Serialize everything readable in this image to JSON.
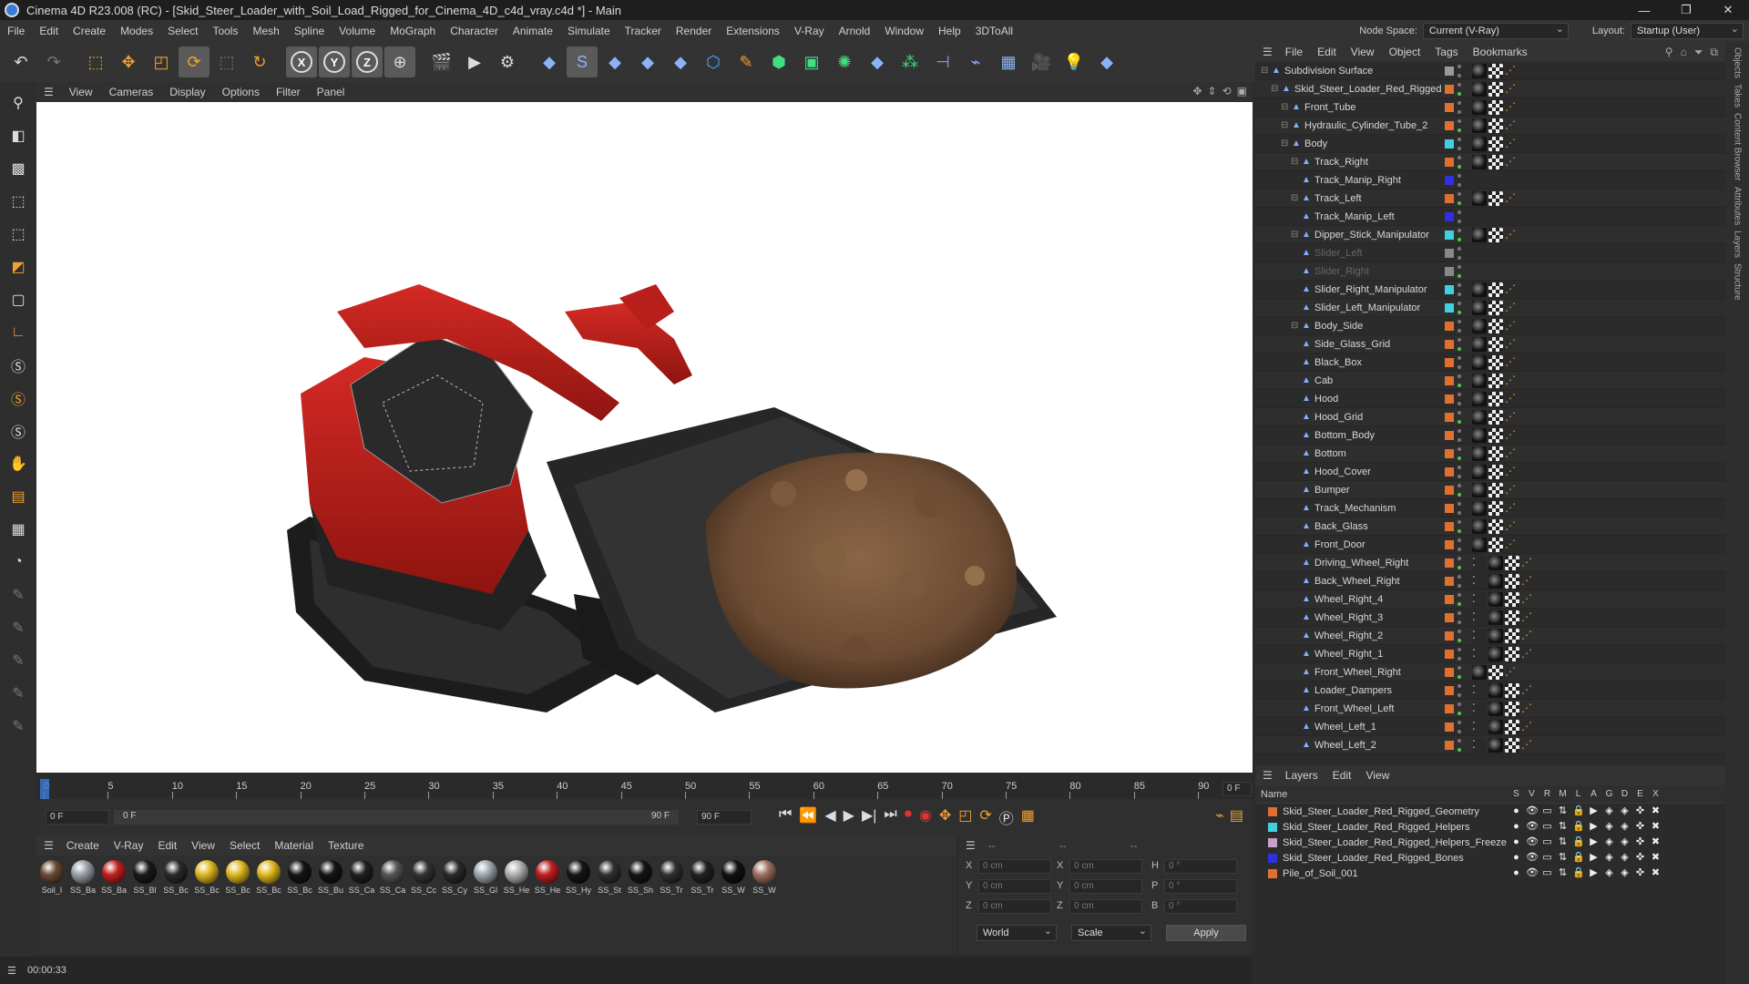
{
  "titlebar": {
    "title": "Cinema 4D R23.008 (RC) - [Skid_Steer_Loader_with_Soil_Load_Rigged_for_Cinema_4D_c4d_vray.c4d *] - Main",
    "minimize": "—",
    "restore": "❐",
    "close": "✕"
  },
  "menubar": {
    "items": [
      "File",
      "Edit",
      "Create",
      "Modes",
      "Select",
      "Tools",
      "Mesh",
      "Spline",
      "Volume",
      "MoGraph",
      "Character",
      "Animate",
      "Simulate",
      "Tracker",
      "Render",
      "Extensions",
      "V-Ray",
      "Arnold",
      "Window",
      "Help",
      "3DToAll"
    ],
    "node_space_label": "Node Space:",
    "node_space_value": "Current (V-Ray)",
    "layout_label": "Layout:",
    "layout_value": "Startup (User)"
  },
  "viewport_menu": {
    "items": [
      "View",
      "Cameras",
      "Display",
      "Options",
      "Filter",
      "Panel"
    ]
  },
  "object_manager": {
    "menu": [
      "File",
      "Edit",
      "View",
      "Object",
      "Tags",
      "Bookmarks"
    ],
    "rows": [
      {
        "name": "Subdivision Surface",
        "indent": 0,
        "color": "#9a9a9a",
        "dim": false
      },
      {
        "name": "Skid_Steer_Loader_Red_Rigged",
        "indent": 1,
        "color": "#e07030",
        "dim": false
      },
      {
        "name": "Front_Tube",
        "indent": 2,
        "color": "#e07030",
        "dim": false
      },
      {
        "name": "Hydraulic_Cylinder_Tube_2",
        "indent": 2,
        "color": "#e07030",
        "dim": false
      },
      {
        "name": "Body",
        "indent": 2,
        "color": "#40d0e0",
        "dim": false
      },
      {
        "name": "Track_Right",
        "indent": 3,
        "color": "#e07030",
        "dim": false
      },
      {
        "name": "Track_Manip_Right",
        "indent": 3,
        "color": "#3030e0",
        "dim": false
      },
      {
        "name": "Track_Left",
        "indent": 3,
        "color": "#e07030",
        "dim": false
      },
      {
        "name": "Track_Manip_Left",
        "indent": 3,
        "color": "#3030e0",
        "dim": false
      },
      {
        "name": "Dipper_Stick_Manipulator",
        "indent": 3,
        "color": "#40d0e0",
        "dim": false
      },
      {
        "name": "Slider_Left",
        "indent": 3,
        "color": "#888888",
        "dim": true
      },
      {
        "name": "Slider_Right",
        "indent": 3,
        "color": "#888888",
        "dim": true
      },
      {
        "name": "Slider_Right_Manipulator",
        "indent": 3,
        "color": "#40d0e0",
        "dim": false
      },
      {
        "name": "Slider_Left_Manipulator",
        "indent": 3,
        "color": "#40d0e0",
        "dim": false
      },
      {
        "name": "Body_Side",
        "indent": 3,
        "color": "#e07030",
        "dim": false
      },
      {
        "name": "Side_Glass_Grid",
        "indent": 3,
        "color": "#e07030",
        "dim": false
      },
      {
        "name": "Black_Box",
        "indent": 3,
        "color": "#e07030",
        "dim": false
      },
      {
        "name": "Cab",
        "indent": 3,
        "color": "#e07030",
        "dim": false
      },
      {
        "name": "Hood",
        "indent": 3,
        "color": "#e07030",
        "dim": false
      },
      {
        "name": "Hood_Grid",
        "indent": 3,
        "color": "#e07030",
        "dim": false
      },
      {
        "name": "Bottom_Body",
        "indent": 3,
        "color": "#e07030",
        "dim": false
      },
      {
        "name": "Bottom",
        "indent": 3,
        "color": "#e07030",
        "dim": false
      },
      {
        "name": "Hood_Cover",
        "indent": 3,
        "color": "#e07030",
        "dim": false
      },
      {
        "name": "Bumper",
        "indent": 3,
        "color": "#e07030",
        "dim": false
      },
      {
        "name": "Track_Mechanism",
        "indent": 3,
        "color": "#e07030",
        "dim": false
      },
      {
        "name": "Back_Glass",
        "indent": 3,
        "color": "#e07030",
        "dim": false
      },
      {
        "name": "Front_Door",
        "indent": 3,
        "color": "#e07030",
        "dim": false
      },
      {
        "name": "Driving_Wheel_Right",
        "indent": 3,
        "color": "#e07030",
        "dim": false
      },
      {
        "name": "Back_Wheel_Right",
        "indent": 3,
        "color": "#e07030",
        "dim": false
      },
      {
        "name": "Wheel_Right_4",
        "indent": 3,
        "color": "#e07030",
        "dim": false
      },
      {
        "name": "Wheel_Right_3",
        "indent": 3,
        "color": "#e07030",
        "dim": false
      },
      {
        "name": "Wheel_Right_2",
        "indent": 3,
        "color": "#e07030",
        "dim": false
      },
      {
        "name": "Wheel_Right_1",
        "indent": 3,
        "color": "#e07030",
        "dim": false
      },
      {
        "name": "Front_Wheel_Right",
        "indent": 3,
        "color": "#e07030",
        "dim": false
      },
      {
        "name": "Loader_Dampers",
        "indent": 3,
        "color": "#e07030",
        "dim": false
      },
      {
        "name": "Front_Wheel_Left",
        "indent": 3,
        "color": "#e07030",
        "dim": false
      },
      {
        "name": "Wheel_Left_1",
        "indent": 3,
        "color": "#e07030",
        "dim": false
      },
      {
        "name": "Wheel_Left_2",
        "indent": 3,
        "color": "#e07030",
        "dim": false
      }
    ]
  },
  "layer_manager": {
    "menu": [
      "Layers",
      "Edit",
      "View"
    ],
    "name_header": "Name",
    "flag_headers": [
      "S",
      "V",
      "R",
      "M",
      "L",
      "A",
      "G",
      "D",
      "E",
      "X"
    ],
    "layers": [
      {
        "name": "Skid_Steer_Loader_Red_Rigged_Geometry",
        "color": "#e07030"
      },
      {
        "name": "Skid_Steer_Loader_Red_Rigged_Helpers",
        "color": "#40d0e0"
      },
      {
        "name": "Skid_Steer_Loader_Red_Rigged_Helpers_Freeze",
        "color": "#c8a0c8"
      },
      {
        "name": "Skid_Steer_Loader_Red_Rigged_Bones",
        "color": "#3030e0"
      },
      {
        "name": "Pile_of_Soil_001",
        "color": "#e07030"
      }
    ]
  },
  "timeline": {
    "ticks": [
      "0",
      "5",
      "10",
      "15",
      "20",
      "25",
      "30",
      "35",
      "40",
      "45",
      "50",
      "55",
      "60",
      "65",
      "70",
      "75",
      "80",
      "85",
      "90"
    ],
    "current_frame": "0 F"
  },
  "transport": {
    "start_field": "0 F",
    "range_start": "0 F",
    "range_end": "90 F",
    "end_field": "90 F"
  },
  "material_manager": {
    "menu": [
      "Create",
      "V-Ray",
      "Edit",
      "View",
      "Select",
      "Material",
      "Texture"
    ],
    "materials": [
      {
        "label": "Soil_I",
        "color": "#6a4a35"
      },
      {
        "label": "SS_Ba",
        "color": "#9aa0a8"
      },
      {
        "label": "SS_Ba",
        "color": "#c02020"
      },
      {
        "label": "SS_Bl",
        "color": "#1a1a1a"
      },
      {
        "label": "SS_Bc",
        "color": "#2a2a2a"
      },
      {
        "label": "SS_Bc",
        "color": "#e0b820"
      },
      {
        "label": "SS_Bc",
        "color": "#e0b820"
      },
      {
        "label": "SS_Bc",
        "color": "#e0b820"
      },
      {
        "label": "SS_Bc",
        "color": "#151515"
      },
      {
        "label": "SS_Bu",
        "color": "#151515"
      },
      {
        "label": "SS_Ca",
        "color": "#202020"
      },
      {
        "label": "SS_Ca",
        "color": "#555555"
      },
      {
        "label": "SS_Cc",
        "color": "#333333"
      },
      {
        "label": "SS_Cy",
        "color": "#2a2a2a"
      },
      {
        "label": "SS_Gl",
        "color": "#a0a8b0"
      },
      {
        "label": "SS_He",
        "color": "#b0b0b0"
      },
      {
        "label": "SS_He",
        "color": "#c02020"
      },
      {
        "label": "SS_Hy",
        "color": "#151515"
      },
      {
        "label": "SS_St",
        "color": "#303030"
      },
      {
        "label": "SS_Sh",
        "color": "#151515"
      },
      {
        "label": "SS_Tr",
        "color": "#303030"
      },
      {
        "label": "SS_Tr",
        "color": "#222222"
      },
      {
        "label": "SS_W",
        "color": "#111111"
      },
      {
        "label": "SS_W",
        "color": "#a07060"
      }
    ]
  },
  "coordinates": {
    "dash1": "--",
    "dash2": "--",
    "dash3": "--",
    "rows": [
      {
        "a": "X",
        "av": "0 cm",
        "b": "X",
        "bv": "0 cm",
        "c": "H",
        "cv": "0 °"
      },
      {
        "a": "Y",
        "av": "0 cm",
        "b": "Y",
        "bv": "0 cm",
        "c": "P",
        "cv": "0 °"
      },
      {
        "a": "Z",
        "av": "0 cm",
        "b": "Z",
        "bv": "0 cm",
        "c": "B",
        "cv": "0 °"
      }
    ],
    "world": "World",
    "scale": "Scale",
    "apply": "Apply"
  },
  "statusbar": {
    "time": "00:00:33"
  },
  "right_strip": {
    "tabs": [
      "Objects",
      "Takes",
      "Content Browser",
      "Attributes",
      "Layers",
      "Structure"
    ]
  }
}
